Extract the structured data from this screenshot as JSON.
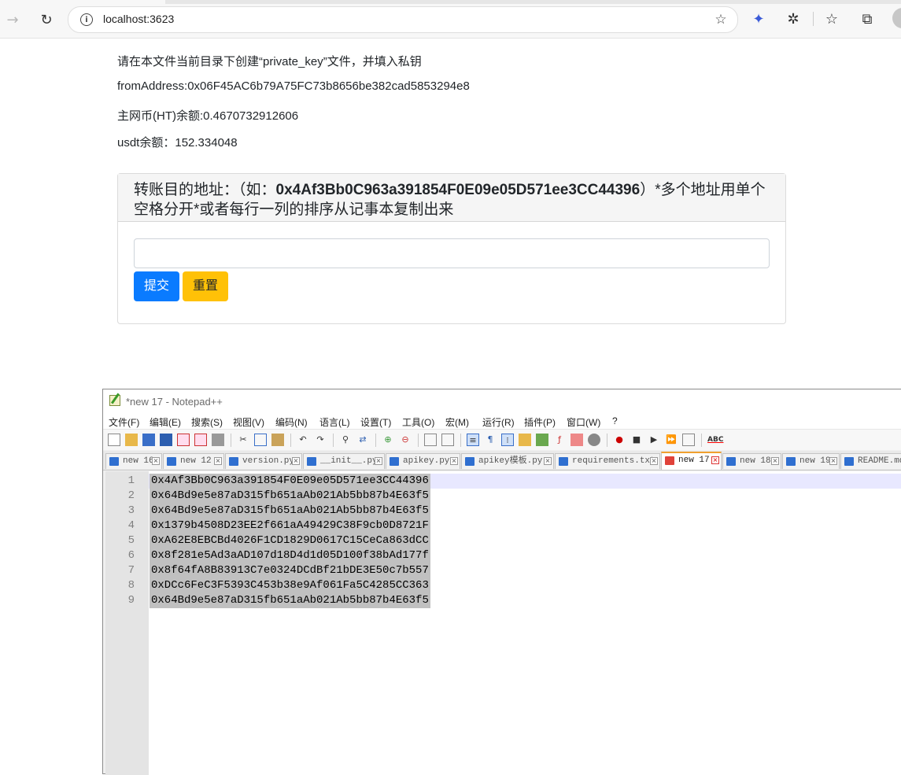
{
  "browser": {
    "url": "localhost:3623"
  },
  "page": {
    "instruction": "请在本文件当前目录下创建“private_key”文件，并填入私钥",
    "from_address": "fromAddress:0x06F45AC6b79A75FC73b8656be382cad5853294e8",
    "ht_balance": "主网币(HT)余额:0.4670732912606",
    "usdt_balance": "usdt余额：152.334048",
    "card": {
      "title_prefix": "转账目的地址：（如：",
      "title_example": "0x4Af3Bb0C963a391854F0E09e05D571ee3CC44396",
      "title_suffix": "）*多个地址用单个空格分开*或者每行一列的排序从记事本复制出来",
      "input_value": "",
      "submit_label": "提交",
      "reset_label": "重置"
    }
  },
  "notepad": {
    "title": "*new 17 - Notepad++",
    "menu": [
      "文件(F)",
      "编辑(E)",
      "搜索(S)",
      "视图(V)",
      "编码(N)",
      "语言(L)",
      "设置(T)",
      "工具(O)",
      "宏(M)",
      "运行(R)",
      "插件(P)",
      "窗口(W)",
      "?"
    ],
    "tabs": [
      "new 16",
      "new 12",
      "version.py",
      "__init__.py",
      "apikey.py",
      "apikey模板.py",
      "requirements.txt",
      "new 17",
      "new 18",
      "new 19",
      "README.md"
    ],
    "active_tab": "new 17",
    "line_numbers": [
      "1",
      "2",
      "3",
      "4",
      "5",
      "6",
      "7",
      "8",
      "9"
    ],
    "lines": [
      "0x4Af3Bb0C963a391854F0E09e05D571ee3CC44396",
      "0x64Bd9e5e87aD315fb651aAb021Ab5bb87b4E63f5",
      "0x64Bd9e5e87aD315fb651aAb021Ab5bb87b4E63f5",
      "0x1379b4508D23EE2f661aA49429C38F9cb0D8721F",
      "0xA62E8EBCBd4026F1CD1829D0617C15CeCa863dCC",
      "0x8f281e5Ad3aAD107d18D4d1d05D100f38bAd177f",
      "0x8f64fA8B83913C7e0324DCdBf21bDE3E50c7b557",
      "0xDCc6FeC3F5393C453b38e9Af061Fa5C4285CC363",
      "0x64Bd9e5e87aD315fb651aAb021Ab5bb87b4E63f5"
    ]
  }
}
